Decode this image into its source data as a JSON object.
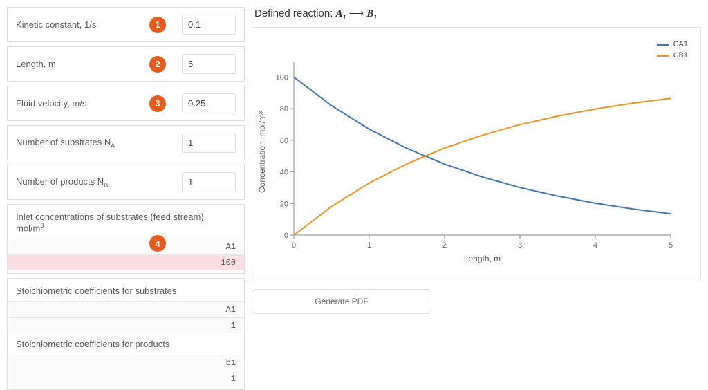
{
  "params": [
    {
      "label_html": "Kinetic constant, 1/s",
      "value": "0.1",
      "marker": "1"
    },
    {
      "label_html": "Length, m",
      "value": "5",
      "marker": "2"
    },
    {
      "label_html": "Fluid velocity, m/s",
      "value": "0.25",
      "marker": "3"
    },
    {
      "label_html": "Number of substrates N<sub>A</sub>",
      "value": "1",
      "marker": null
    },
    {
      "label_html": "Number of products N<sub>B</sub>",
      "value": "1",
      "marker": null
    }
  ],
  "inlet_section": {
    "title_html": "Inlet concentrations of substrates (feed stream), mol/m<sup>3</sup>",
    "marker": "4",
    "rows": [
      {
        "text": "A1",
        "highlight": false
      },
      {
        "text": "100",
        "highlight": true
      }
    ]
  },
  "stoich_sub": {
    "title": "Stoichiometric coefficients for substrates",
    "rows": [
      {
        "text": "A1"
      },
      {
        "text": "1"
      }
    ]
  },
  "stoich_prod": {
    "title": "Stoichiometric coefficients for products",
    "rows": [
      {
        "text": "b1"
      },
      {
        "text": "1"
      }
    ]
  },
  "reaction": {
    "prefix": "Defined reaction: ",
    "lhs_base": "A",
    "lhs_sub": "1",
    "arrow": " ⟶ ",
    "rhs_base": "B",
    "rhs_sub": "1"
  },
  "generate_label": "Generate PDF",
  "legend": {
    "series1": {
      "name": "CA1",
      "color": "#3a78b5"
    },
    "series2": {
      "name": "CB1",
      "color": "#f39322"
    }
  },
  "chart_data": {
    "type": "line",
    "xlabel": "Length, m",
    "ylabel": "Concentration, mol/m³",
    "xlim": [
      0,
      5
    ],
    "ylim": [
      0,
      105
    ],
    "x_ticks": [
      0,
      1,
      2,
      3,
      4,
      5
    ],
    "y_ticks": [
      0,
      20,
      40,
      60,
      80,
      100
    ],
    "x": [
      0,
      0.5,
      1.0,
      1.5,
      2.0,
      2.5,
      3.0,
      3.5,
      4.0,
      4.5,
      5.0
    ],
    "series": [
      {
        "name": "CA1",
        "color": "#3a78b5",
        "values": [
          100.0,
          81.9,
          67.0,
          54.9,
          44.9,
          36.8,
          30.1,
          24.7,
          20.2,
          16.5,
          13.5
        ]
      },
      {
        "name": "CB1",
        "color": "#f39322",
        "values": [
          0.0,
          18.1,
          33.0,
          45.1,
          55.1,
          63.2,
          69.9,
          75.3,
          79.8,
          83.5,
          86.5
        ]
      }
    ]
  }
}
